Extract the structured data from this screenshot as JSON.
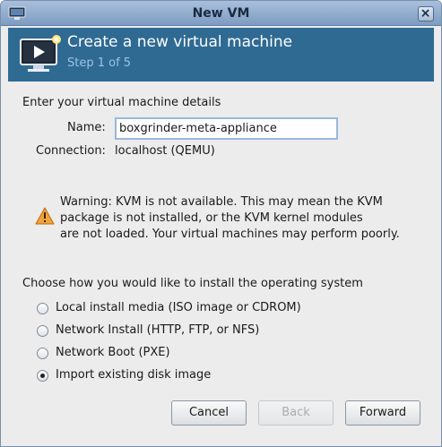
{
  "window": {
    "title": "New VM"
  },
  "header": {
    "title": "Create a new virtual machine",
    "step": "Step 1 of 5"
  },
  "details": {
    "section_label": "Enter your virtual machine details",
    "name_label": "Name:",
    "name_value": "boxgrinder-meta-appliance",
    "connection_label": "Connection:",
    "connection_value": "localhost (QEMU)"
  },
  "warning": {
    "line1": "Warning: KVM is not available. This may mean the KVM",
    "line2": "package is not installed, or the KVM kernel modules",
    "line3": "are not loaded. Your virtual machines may perform poorly."
  },
  "install": {
    "section_label": "Choose how you would like to install the operating system",
    "options": [
      {
        "label": "Local install media (ISO image or CDROM)",
        "checked": false
      },
      {
        "label": "Network Install (HTTP, FTP, or NFS)",
        "checked": false
      },
      {
        "label": "Network Boot (PXE)",
        "checked": false
      },
      {
        "label": "Import existing disk image",
        "checked": true
      }
    ]
  },
  "buttons": {
    "cancel": "Cancel",
    "back": "Back",
    "forward": "Forward"
  },
  "colors": {
    "banner": "#2f6a93",
    "banner_step": "#9ec3e3",
    "titlebar": "#7d9bc2"
  },
  "icons": {
    "app": "vm-app-icon",
    "close": "close-icon",
    "banner": "monitor-play-icon",
    "warning": "warning-triangle-icon"
  }
}
